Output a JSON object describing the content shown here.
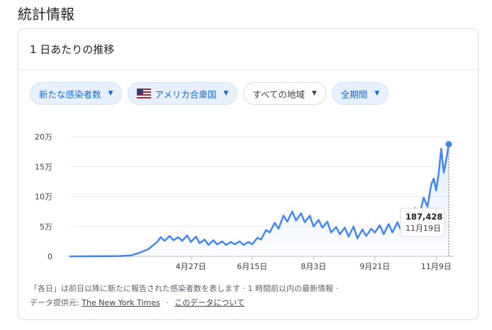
{
  "page": {
    "title": "統計情報"
  },
  "card": {
    "header": "1 日あたりの推移"
  },
  "filters": {
    "metric": "新たな感染者数",
    "country": "アメリカ合衆国",
    "region": "すべての地域",
    "period": "全期間"
  },
  "tooltip": {
    "value": "187,428",
    "date": "11月19日"
  },
  "footer": {
    "line1": "「各日」は前日以降に新たに報告された感染者数を表します · 1 時間前以内の最新情報 ·",
    "source_label": "データ提供元:",
    "source_link": "The New York Times",
    "about_link": "このデータについて",
    "separator": "·"
  },
  "colors": {
    "line": "#4285f4",
    "accent": "#1967d2",
    "chip_bg": "#e8f0fe"
  },
  "chart_data": {
    "type": "line",
    "title": "",
    "xlabel": "",
    "ylabel": "",
    "ylim": [
      0,
      200000
    ],
    "y_ticks": [
      0,
      50000,
      100000,
      150000,
      200000
    ],
    "y_tick_labels": [
      "0",
      "5万",
      "10万",
      "15万",
      "20万"
    ],
    "x_range": [
      "1月21日",
      "11月19日"
    ],
    "x_ticks": [
      "4月27日",
      "6月15日",
      "8月3日",
      "9月21日",
      "11月9日"
    ],
    "series": [
      {
        "points": [
          [
            "1月21日",
            0
          ],
          [
            "3月1日",
            500
          ],
          [
            "3月10日",
            1500
          ],
          [
            "3月17日",
            6000
          ],
          [
            "3月24日",
            12000
          ],
          [
            "3月31日",
            24000
          ],
          [
            "4月3日",
            32000
          ],
          [
            "4月6日",
            26000
          ],
          [
            "4月10日",
            34000
          ],
          [
            "4月13日",
            27000
          ],
          [
            "4月17日",
            32000
          ],
          [
            "4月20日",
            26000
          ],
          [
            "4月24日",
            35000
          ],
          [
            "4月27日",
            24000
          ],
          [
            "5月1日",
            33000
          ],
          [
            "5月4日",
            22000
          ],
          [
            "5月8日",
            28000
          ],
          [
            "5月11日",
            19000
          ],
          [
            "5月15日",
            27000
          ],
          [
            "5月18日",
            20000
          ],
          [
            "5月22日",
            25000
          ],
          [
            "5月25日",
            19000
          ],
          [
            "5月29日",
            24000
          ],
          [
            "6月1日",
            20000
          ],
          [
            "6月5日",
            25000
          ],
          [
            "6月8日",
            19000
          ],
          [
            "6月12日",
            24000
          ],
          [
            "6月15日",
            20000
          ],
          [
            "6月19日",
            31000
          ],
          [
            "6月22日",
            28000
          ],
          [
            "6月26日",
            44000
          ],
          [
            "6月29日",
            40000
          ],
          [
            "7月3日",
            56000
          ],
          [
            "7月6日",
            46000
          ],
          [
            "7月10日",
            68000
          ],
          [
            "7月13日",
            58000
          ],
          [
            "7月17日",
            75000
          ],
          [
            "7月20日",
            60000
          ],
          [
            "7月24日",
            72000
          ],
          [
            "7月27日",
            57000
          ],
          [
            "7月31日",
            68000
          ],
          [
            "8月3日",
            50000
          ],
          [
            "8月7日",
            61000
          ],
          [
            "8月10日",
            48000
          ],
          [
            "8月14日",
            58000
          ],
          [
            "8月17日",
            40000
          ],
          [
            "8月21日",
            49000
          ],
          [
            "8月24日",
            37000
          ],
          [
            "8月28日",
            48000
          ],
          [
            "8月31日",
            33000
          ],
          [
            "9月4日",
            50000
          ],
          [
            "9月7日",
            30000
          ],
          [
            "9月11日",
            45000
          ],
          [
            "9月14日",
            34000
          ],
          [
            "9月18日",
            46000
          ],
          [
            "9月21日",
            40000
          ],
          [
            "9月25日",
            52000
          ],
          [
            "9月28日",
            37000
          ],
          [
            "10月2日",
            54000
          ],
          [
            "10月5日",
            40000
          ],
          [
            "10月9日",
            57000
          ],
          [
            "10月12日",
            43000
          ],
          [
            "10月16日",
            68000
          ],
          [
            "10月19日",
            55000
          ],
          [
            "10月23日",
            81000
          ],
          [
            "10月26日",
            65000
          ],
          [
            "10月30日",
            98000
          ],
          [
            "11月2日",
            83000
          ],
          [
            "11月5日",
            120000
          ],
          [
            "11月7日",
            130000
          ],
          [
            "11月9日",
            110000
          ],
          [
            "11月11日",
            140000
          ],
          [
            "11月13日",
            180000
          ],
          [
            "11月15日",
            140000
          ],
          [
            "11月17日",
            162000
          ],
          [
            "11月19日",
            187428
          ]
        ]
      }
    ]
  }
}
